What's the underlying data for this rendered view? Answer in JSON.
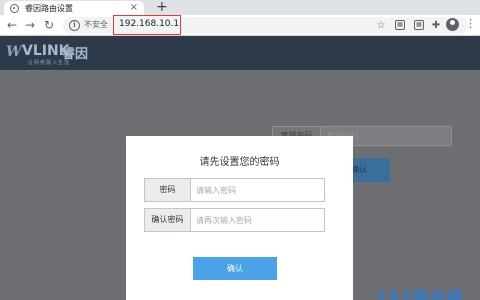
{
  "browser": {
    "tab_title": "睿因路由设置",
    "tab_close": "×",
    "new_tab": "+",
    "back": "←",
    "forward": "→",
    "reload": "↻",
    "security_label": "不安全",
    "url": "192.168.10.1",
    "menu": "⋮"
  },
  "header": {
    "logo_mark": "W",
    "logo_text": "VLINK",
    "logo_cn": "睿因",
    "tagline": "让网络融入生活"
  },
  "background_form": {
    "password_label": "管理密码",
    "password_placeholder": "管理密码",
    "confirm_label": "确认"
  },
  "modal": {
    "title": "请先设置您的密码",
    "password_label": "密码",
    "password_placeholder": "请输入密码",
    "confirm_password_label": "确认密码",
    "confirm_password_placeholder": "请再次输入密码",
    "confirm_button": "确认"
  },
  "watermark": "192路由网",
  "colors": {
    "accent": "#4aa3e8",
    "url_highlight": "#e53935",
    "header_bg": "#2c3a4a",
    "overlay": "#6d6f73"
  }
}
